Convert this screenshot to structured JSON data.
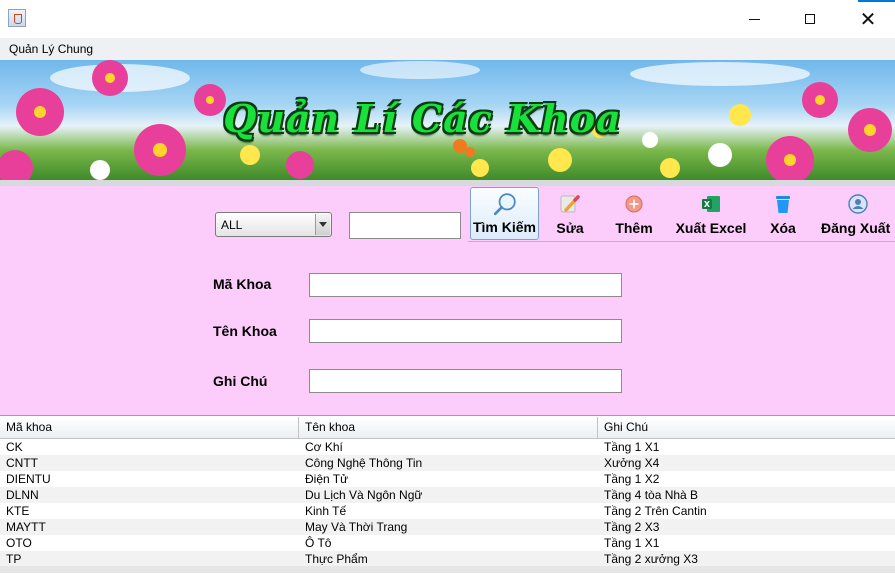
{
  "window": {
    "title": ""
  },
  "menu": {
    "items": [
      "Quản Lý Chung"
    ]
  },
  "banner": {
    "title": "Quản Lí Các Khoa"
  },
  "filter": {
    "selected": "ALL",
    "search_value": ""
  },
  "toolbar": {
    "search_label": "Tìm Kiếm",
    "edit_label": "Sửa",
    "add_label": "Thêm",
    "export_label": "Xuất Excel",
    "delete_label": "Xóa",
    "logout_label": "Đăng Xuất"
  },
  "form": {
    "code_label": "Mã Khoa",
    "name_label": "Tên Khoa",
    "note_label": "Ghi Chú",
    "code_value": "",
    "name_value": "",
    "note_value": ""
  },
  "table": {
    "headers": [
      "Mã khoa",
      "Tên khoa",
      "Ghi Chú"
    ],
    "rows": [
      [
        "CK",
        "Cơ Khí",
        "Tầng 1 X1"
      ],
      [
        "CNTT",
        "Công Nghệ Thông Tin",
        "Xưởng X4"
      ],
      [
        "DIENTU",
        "Điện Tử",
        "Tầng 1 X2"
      ],
      [
        "DLNN",
        "Du Lịch Và Ngôn Ngữ",
        "Tầng 4 tòa Nhà B"
      ],
      [
        "KTE",
        "Kinh Tế",
        "Tầng 2 Trên Cantin"
      ],
      [
        "MAYTT",
        "May Và Thời Trang",
        "Tầng 2 X3"
      ],
      [
        "OTO",
        "Ô Tô",
        "Tầng 1 X1"
      ],
      [
        "TP",
        "Thực Phẩm",
        "Tầng 2  xưởng X3"
      ]
    ]
  },
  "colors": {
    "panel": "#fcccfb",
    "banner_text": "#19e03a",
    "accent": "#0078d7"
  },
  "icons": [
    "java-app-icon",
    "search-icon",
    "edit-icon",
    "add-icon",
    "excel-icon",
    "trash-icon",
    "user-icon"
  ]
}
